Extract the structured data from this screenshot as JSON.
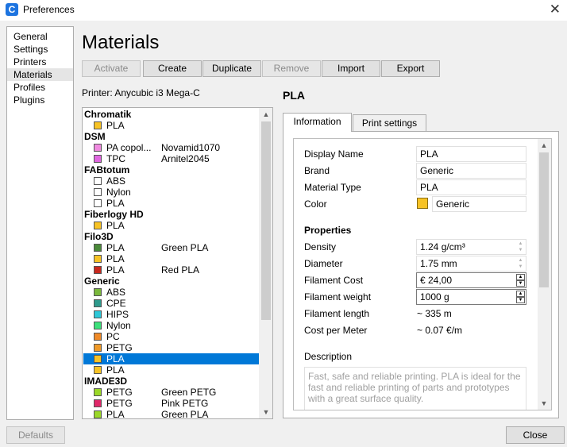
{
  "window": {
    "title": "Preferences",
    "app_icon_letter": "C"
  },
  "nav": {
    "items": [
      {
        "label": "General",
        "selected": false
      },
      {
        "label": "Settings",
        "selected": false
      },
      {
        "label": "Printers",
        "selected": false
      },
      {
        "label": "Materials",
        "selected": true
      },
      {
        "label": "Profiles",
        "selected": false
      },
      {
        "label": "Plugins",
        "selected": false
      }
    ]
  },
  "page_title": "Materials",
  "toolbar": {
    "buttons": [
      {
        "label": "Activate",
        "enabled": false
      },
      {
        "label": "Create",
        "enabled": true
      },
      {
        "label": "Duplicate",
        "enabled": true
      },
      {
        "label": "Remove",
        "enabled": false
      },
      {
        "label": "Import",
        "enabled": true
      },
      {
        "label": "Export",
        "enabled": true
      }
    ]
  },
  "printer_label": "Printer: Anycubic i3 Mega-C",
  "materials": [
    {
      "brand": "Chromatik",
      "items": [
        {
          "type": "PLA",
          "name": "",
          "color": "#f7c325"
        }
      ]
    },
    {
      "brand": "DSM",
      "items": [
        {
          "type": "PA copol...",
          "name": "Novamid1070",
          "color": "#f08ae0"
        },
        {
          "type": "TPC",
          "name": "Arnitel2045",
          "color": "#e066e0"
        }
      ]
    },
    {
      "brand": "FABtotum",
      "items": [
        {
          "type": "ABS",
          "name": "",
          "color": "#ffffff"
        },
        {
          "type": "Nylon",
          "name": "",
          "color": "#ffffff"
        },
        {
          "type": "PLA",
          "name": "",
          "color": "#ffffff"
        }
      ]
    },
    {
      "brand": "Fiberlogy HD",
      "items": [
        {
          "type": "PLA",
          "name": "",
          "color": "#f7c325"
        }
      ]
    },
    {
      "brand": "Filo3D",
      "items": [
        {
          "type": "PLA",
          "name": "Green PLA",
          "color": "#4a8a3a"
        },
        {
          "type": "PLA",
          "name": "",
          "color": "#f7c325"
        },
        {
          "type": "PLA",
          "name": "Red PLA",
          "color": "#c8281e"
        }
      ]
    },
    {
      "brand": "Generic",
      "items": [
        {
          "type": "ABS",
          "name": "",
          "color": "#7ab83c"
        },
        {
          "type": "CPE",
          "name": "",
          "color": "#2e9a8c"
        },
        {
          "type": "HIPS",
          "name": "",
          "color": "#2ec8d8"
        },
        {
          "type": "Nylon",
          "name": "",
          "color": "#3ce07a"
        },
        {
          "type": "PC",
          "name": "",
          "color": "#f08a28"
        },
        {
          "type": "PETG",
          "name": "",
          "color": "#f09a28"
        },
        {
          "type": "PLA",
          "name": "",
          "color": "#f7c325",
          "selected": true
        },
        {
          "type": "PLA",
          "name": "",
          "color": "#f7c325"
        }
      ]
    },
    {
      "brand": "IMADE3D",
      "items": [
        {
          "type": "PETG",
          "name": "Green PETG",
          "color": "#9ad828"
        },
        {
          "type": "PETG",
          "name": "Pink PETG",
          "color": "#e0286a"
        },
        {
          "type": "PLA",
          "name": "Green PLA",
          "color": "#9ad828"
        }
      ]
    }
  ],
  "detail": {
    "title": "PLA",
    "tabs": [
      "Information",
      "Print settings"
    ],
    "fields": {
      "display_name_label": "Display Name",
      "display_name": "PLA",
      "brand_label": "Brand",
      "brand": "Generic",
      "material_type_label": "Material Type",
      "material_type": "PLA",
      "color_label": "Color",
      "color_name": "Generic",
      "color_hex": "#f7c325"
    },
    "properties": {
      "heading": "Properties",
      "density_label": "Density",
      "density": "1.24 g/cm³",
      "diameter_label": "Diameter",
      "diameter": "1.75 mm",
      "filament_cost_label": "Filament Cost",
      "filament_cost": "€ 24,00",
      "filament_weight_label": "Filament weight",
      "filament_weight": "1000 g",
      "filament_length_label": "Filament length",
      "filament_length": "~ 335 m",
      "cost_per_meter_label": "Cost per Meter",
      "cost_per_meter": "~ 0.07 €/m"
    },
    "description": {
      "heading": "Description",
      "text": "Fast, safe and reliable printing. PLA is ideal for the fast and reliable printing of parts and prototypes with a great surface quality."
    }
  },
  "footer": {
    "defaults_label": "Defaults",
    "close_label": "Close"
  }
}
